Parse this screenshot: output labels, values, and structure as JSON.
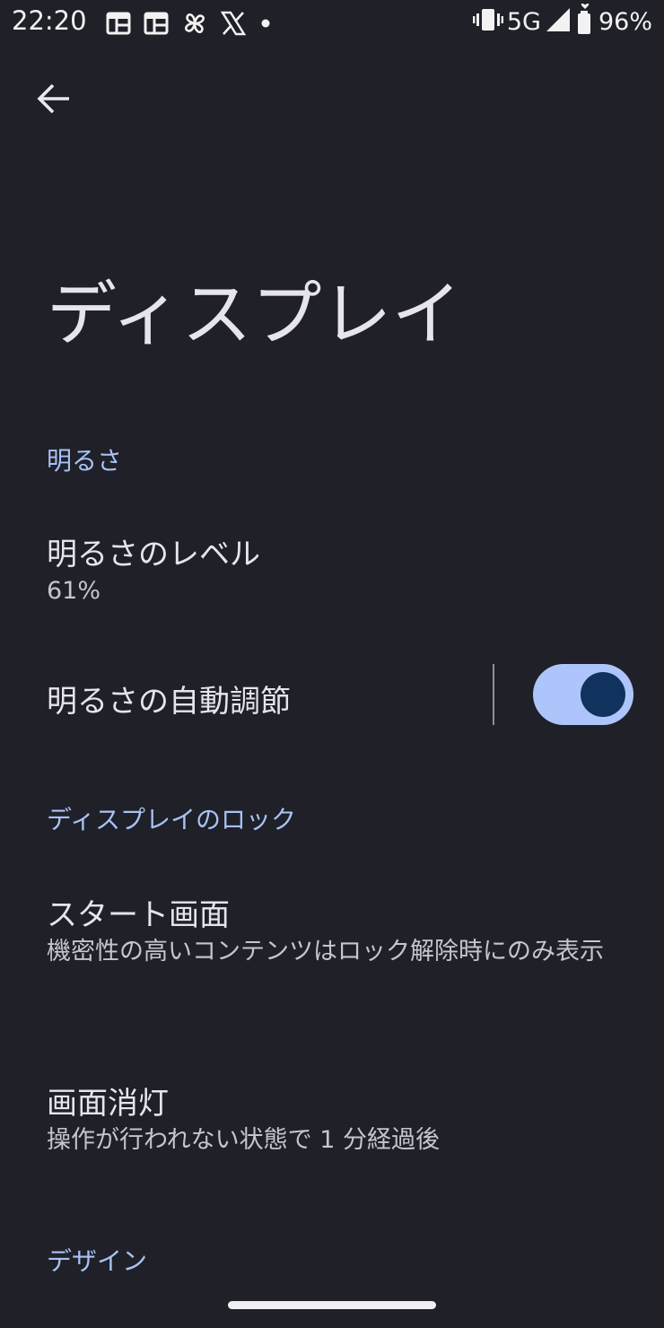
{
  "status_bar": {
    "time": "22:20",
    "network": "5G",
    "battery": "96%",
    "left_icons": [
      "calendar-icon",
      "calendar-icon",
      "pinwheel-icon",
      "x-logo-icon",
      "dot-icon"
    ],
    "right_icons": [
      "vibrate-icon",
      "signal-icon",
      "battery-icon"
    ]
  },
  "header": {
    "back_icon": "arrow-back-icon",
    "title": "ディスプレイ"
  },
  "sections": {
    "brightness": {
      "header": "明るさ",
      "level_title": "明るさのレベル",
      "level_value": "61%",
      "auto_title": "明るさの自動調節",
      "auto_enabled": true
    },
    "lock": {
      "header": "ディスプレイのロック",
      "lockscreen_title": "スタート画面",
      "lockscreen_summary": "機密性の高いコンテンツはロック解除時にのみ表示",
      "timeout_title": "画面消灯",
      "timeout_summary": "操作が行われない状態で 1 分経過後"
    },
    "design": {
      "header": "デザイン"
    }
  },
  "colors": {
    "background": "#1f2028",
    "accent": "#a9c2f5",
    "toggle_track": "#aec5fb",
    "toggle_knob": "#12325e"
  }
}
